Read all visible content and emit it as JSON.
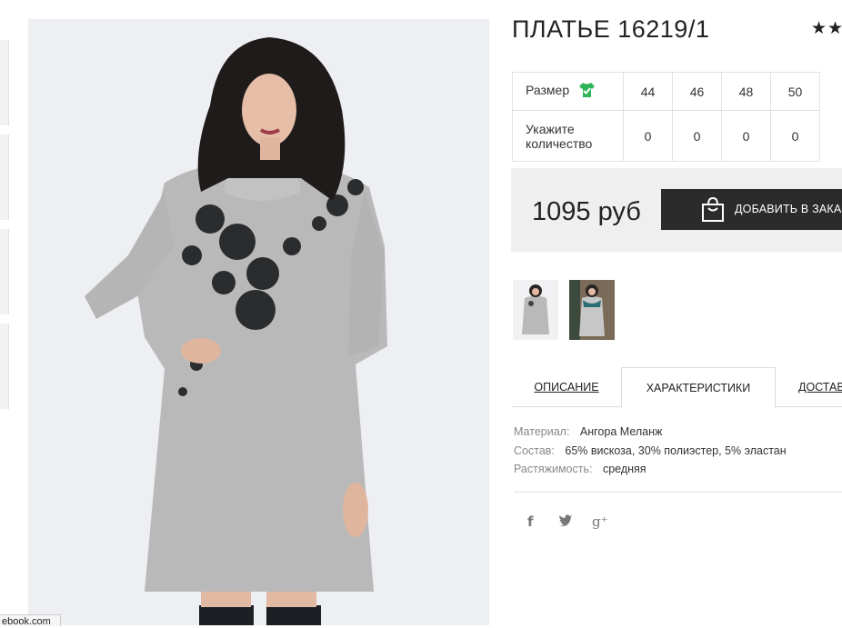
{
  "product": {
    "title": "ПЛАТЬЕ 16219/1",
    "rating_stars": "★★"
  },
  "size_table": {
    "size_label": "Размер",
    "qty_label": "Укажите количество",
    "sizes": [
      "44",
      "46",
      "48",
      "50"
    ],
    "quantities": [
      "0",
      "0",
      "0",
      "0"
    ]
  },
  "purchase": {
    "price": "1095 руб",
    "add_button_label": "ДОБАВИТЬ В ЗАКАЗ"
  },
  "tabs": {
    "description": "ОПИСАНИЕ",
    "characteristics": "ХАРАКТЕРИСТИКИ",
    "delivery": "ДОСТАВ"
  },
  "characteristics": [
    {
      "key": "Материал:",
      "value": "Ангора Меланж"
    },
    {
      "key": "Состав:",
      "value": "65% вискоза, 30% полиэстер, 5% эластан"
    },
    {
      "key": "Растяжимость:",
      "value": "средняя"
    }
  ],
  "social": {
    "facebook_glyph": "f",
    "twitter_glyph": "🐦",
    "gplus_glyph": "g⁺"
  },
  "status_bar": {
    "url": "ebook.com"
  },
  "icons": [
    "check-shirt-icon",
    "shopping-bag-icon",
    "facebook-icon",
    "twitter-icon",
    "google-plus-icon"
  ],
  "colors": {
    "accent_green": "#2fb457",
    "button_dark": "#2b2b2b",
    "price_box_bg": "#efefef"
  }
}
